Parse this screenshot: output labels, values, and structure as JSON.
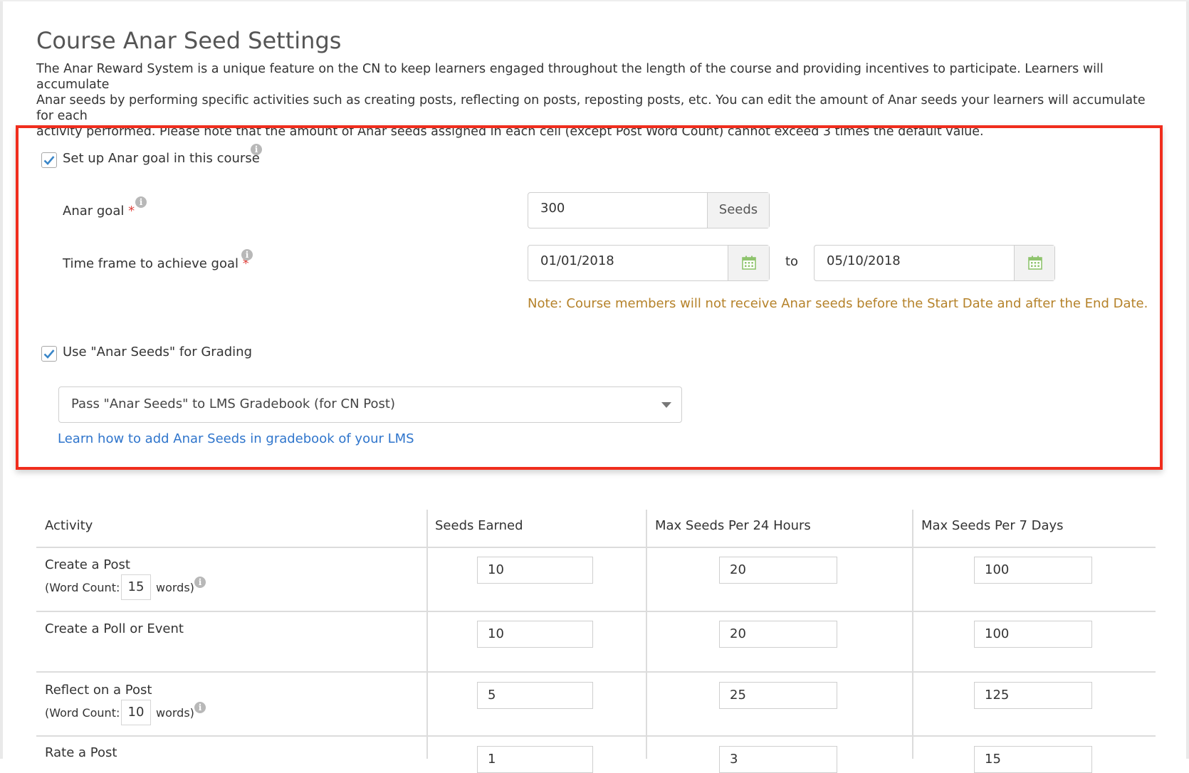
{
  "page": {
    "title": "Course Anar Seed Settings",
    "intro_lines": [
      "The Anar Reward System is a unique feature on the CN to keep learners engaged throughout the length of the course and providing incentives to participate. Learners will accumulate",
      "Anar seeds by performing specific activities such as creating posts, reflecting on posts, reposting posts, etc. You can edit the amount of Anar seeds your learners will accumulate for each",
      "activity performed. Please note that the amount of Anar seeds assigned in each cell (except Post Word Count) cannot exceed 3 times the default value."
    ]
  },
  "goal_section": {
    "setup_checkbox_label": "Set up Anar goal in this course",
    "setup_checked": true,
    "anar_goal_label": "Anar goal",
    "anar_goal_value": "300",
    "anar_goal_unit": "Seeds",
    "timeframe_label": "Time frame to achieve goal",
    "required_mark": "*",
    "start_date": "01/01/2018",
    "to_label": "to",
    "end_date": "05/10/2018",
    "note": "Note: Course members will not receive Anar seeds before the Start Date and after the End Date.",
    "grading_checkbox_label": "Use \"Anar Seeds\" for Grading",
    "grading_checked": true,
    "grading_select_value": "Pass \"Anar Seeds\" to LMS Gradebook (for CN Post)",
    "help_link": "Learn how to add Anar Seeds in gradebook of your LMS",
    "info_glyph": "i"
  },
  "table": {
    "headers": [
      "Activity",
      "Seeds Earned",
      "Max Seeds Per 24 Hours",
      "Max Seeds Per 7 Days"
    ],
    "word_count_prefix": "(Word Count:",
    "word_count_suffix": "words)",
    "rows": [
      {
        "activity": "Create a Post",
        "word_count": "15",
        "seeds": "10",
        "max24": "20",
        "max7": "100"
      },
      {
        "activity": "Create a Poll or Event",
        "word_count": null,
        "seeds": "10",
        "max24": "20",
        "max7": "100"
      },
      {
        "activity": "Reflect on a Post",
        "word_count": "10",
        "seeds": "5",
        "max24": "25",
        "max7": "125"
      },
      {
        "activity": "Rate a Post",
        "word_count": null,
        "seeds": "1",
        "max24": "3",
        "max7": "15"
      }
    ]
  },
  "colors": {
    "highlight_border": "#f02d1d",
    "note_text": "#b5822a",
    "link": "#2f75cc",
    "checkmark": "#3a86c8",
    "calendar_icon": "#8fc46e"
  }
}
